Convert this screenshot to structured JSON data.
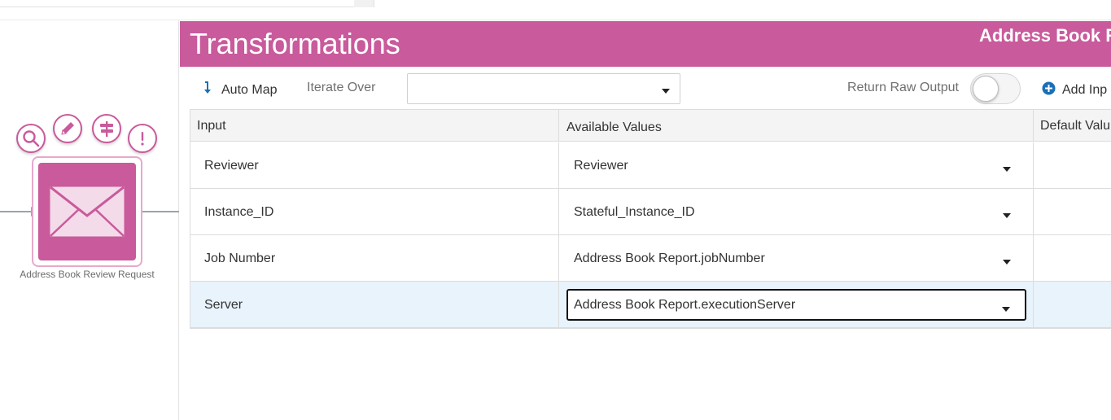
{
  "canvas": {
    "node_label": "Address Book Review Request",
    "accent_color": "#c95a9c",
    "tools": [
      "search-icon",
      "pencil-icon",
      "signpost-icon",
      "exclamation-icon"
    ],
    "node_icon": "envelope-icon"
  },
  "panel": {
    "title": "Transformations",
    "subtitle": "Address Book R",
    "header_color": "#c95a9c"
  },
  "toolbar": {
    "auto_map_label": "Auto Map",
    "iterate_over_label": "Iterate Over",
    "iterate_over_value": "",
    "return_raw_label": "Return Raw Output",
    "return_raw_on": false,
    "add_input_label": "Add Inp"
  },
  "grid": {
    "columns": [
      "Input",
      "Available Values",
      "Default Valu"
    ],
    "rows": [
      {
        "input": "Reviewer",
        "value": "Reviewer",
        "default": ""
      },
      {
        "input": "Instance_ID",
        "value": "Stateful_Instance_ID",
        "default": ""
      },
      {
        "input": "Job Number",
        "value": "Address Book Report.jobNumber",
        "default": ""
      },
      {
        "input": "Server",
        "value": "Address Book Report.executionServer",
        "default": ""
      }
    ],
    "selected_row": 3
  }
}
